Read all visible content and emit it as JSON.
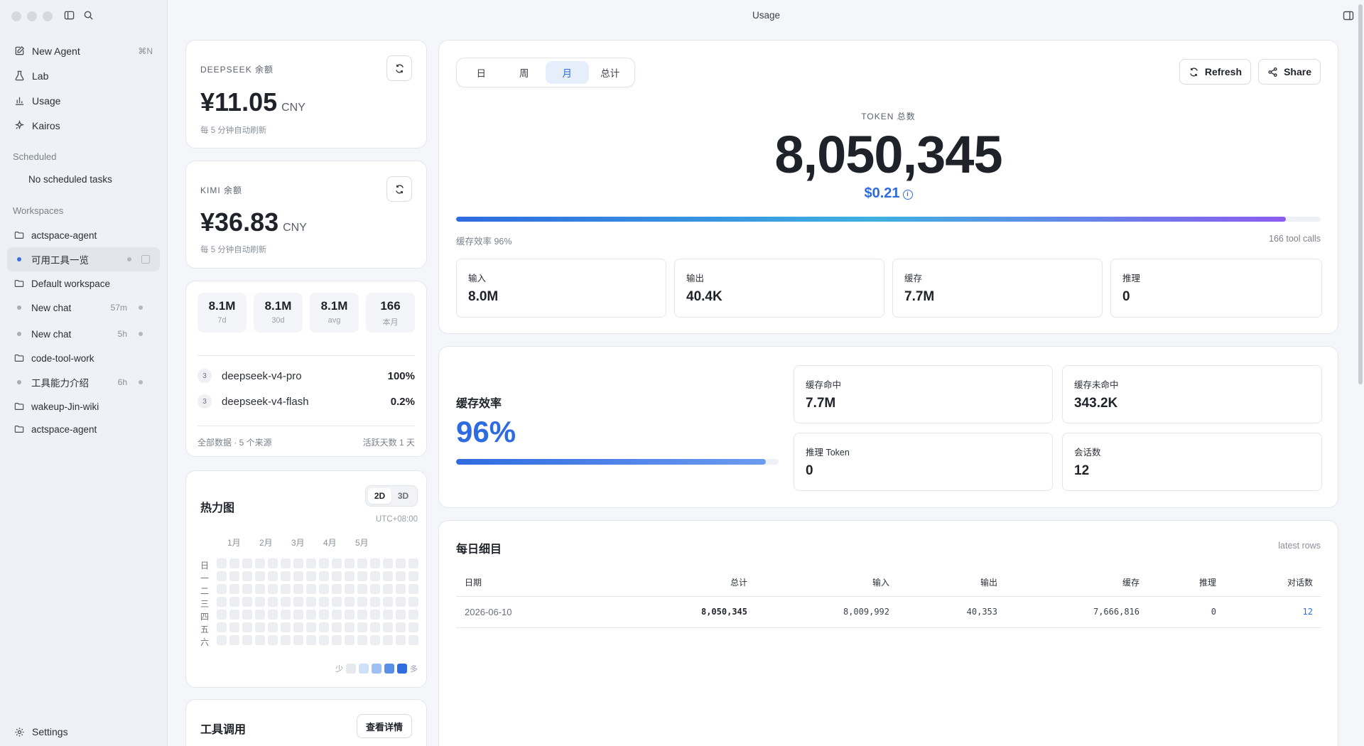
{
  "window": {
    "title": "Usage"
  },
  "sidebar": {
    "nav": [
      {
        "label": "New Agent",
        "shortcut": "⌘N"
      },
      {
        "label": "Lab"
      },
      {
        "label": "Usage"
      },
      {
        "label": "Kairos"
      }
    ],
    "scheduled_heading": "Scheduled",
    "scheduled_empty": "No scheduled tasks",
    "workspaces_heading": "Workspaces",
    "workspaces": [
      {
        "label": "actspace-agent",
        "type": "folder"
      },
      {
        "label": "可用工具一览",
        "type": "chat",
        "active": true
      },
      {
        "label": "Default workspace",
        "type": "folder"
      },
      {
        "label": "New chat",
        "type": "chat",
        "time": "57m"
      },
      {
        "label": "New chat",
        "type": "chat",
        "time": "5h"
      },
      {
        "label": "code-tool-work",
        "type": "folder"
      },
      {
        "label": "工具能力介绍",
        "type": "chat",
        "time": "6h"
      },
      {
        "label": "wakeup-Jin-wiki",
        "type": "folder"
      },
      {
        "label": "actspace-agent",
        "type": "folder"
      }
    ],
    "settings_label": "Settings"
  },
  "balances": {
    "deepseek": {
      "label": "DEEPSEEK 余额",
      "amount": "¥11.05",
      "currency": "CNY",
      "note": "每 5 分钟自动刷新"
    },
    "kimi": {
      "label": "KIMI 余额",
      "amount": "¥36.83",
      "currency": "CNY",
      "note": "每 5 分钟自动刷新"
    }
  },
  "summary": {
    "tiles": [
      {
        "value": "8.1M",
        "key": "7d"
      },
      {
        "value": "8.1M",
        "key": "30d"
      },
      {
        "value": "8.1M",
        "key": "avg"
      },
      {
        "value": "166",
        "key": "本月"
      }
    ],
    "models": [
      {
        "rank": "3",
        "name": "deepseek-v4-pro",
        "pct": "100%"
      },
      {
        "rank": "3",
        "name": "deepseek-v4-flash",
        "pct": "0.2%"
      }
    ],
    "footer_left": "全部数据 · 5 个来源",
    "footer_right": "活跃天数 1 天"
  },
  "heatmap": {
    "title": "热力图",
    "modes": [
      "2D",
      "3D"
    ],
    "timezone": "UTC+08:00",
    "months": [
      "1月",
      "2月",
      "3月",
      "4月",
      "5月"
    ],
    "weekdays": [
      "日",
      "一",
      "二",
      "三",
      "四",
      "五",
      "六"
    ],
    "legend_low": "少",
    "legend_high": "多",
    "legend_colors": [
      "#e6e9ee",
      "#cfe0fb",
      "#9fc0f5",
      "#5a8fe8",
      "#2f6be0"
    ]
  },
  "tools": {
    "title": "工具调用",
    "details_button": "查看详情"
  },
  "main": {
    "tabs": [
      "日",
      "周",
      "月",
      "总计"
    ],
    "active_tab": "月",
    "refresh_label": "Refresh",
    "share_label": "Share",
    "token_label": "TOKEN 总数",
    "token_total": "8,050,345",
    "cost": "$0.21",
    "cache_rate_text": "缓存效率 96%",
    "cache_rate": 0.96,
    "tool_calls": "166 tool calls",
    "metrics": [
      {
        "key": "输入",
        "value": "8.0M"
      },
      {
        "key": "输出",
        "value": "40.4K"
      },
      {
        "key": "缓存",
        "value": "7.7M"
      },
      {
        "key": "推理",
        "value": "0"
      }
    ],
    "colors": {
      "accent": "#2f6be0",
      "gradient": [
        "#2f6be0",
        "#3fb0e0",
        "#8b5cf0"
      ]
    }
  },
  "cache": {
    "title": "缓存效率",
    "value": "96%",
    "fraction": 0.96,
    "stats": [
      {
        "key": "缓存命中",
        "value": "7.7M"
      },
      {
        "key": "缓存未命中",
        "value": "343.2K"
      },
      {
        "key": "推理 Token",
        "value": "0"
      },
      {
        "key": "会话数",
        "value": "12"
      }
    ]
  },
  "daily": {
    "title": "每日细目",
    "note": "latest rows",
    "columns": [
      "日期",
      "总计",
      "输入",
      "输出",
      "缓存",
      "推理",
      "对话数"
    ],
    "rows": [
      [
        "2026-06-10",
        "8,050,345",
        "8,009,992",
        "40,353",
        "7,666,816",
        "0",
        "12"
      ]
    ]
  }
}
